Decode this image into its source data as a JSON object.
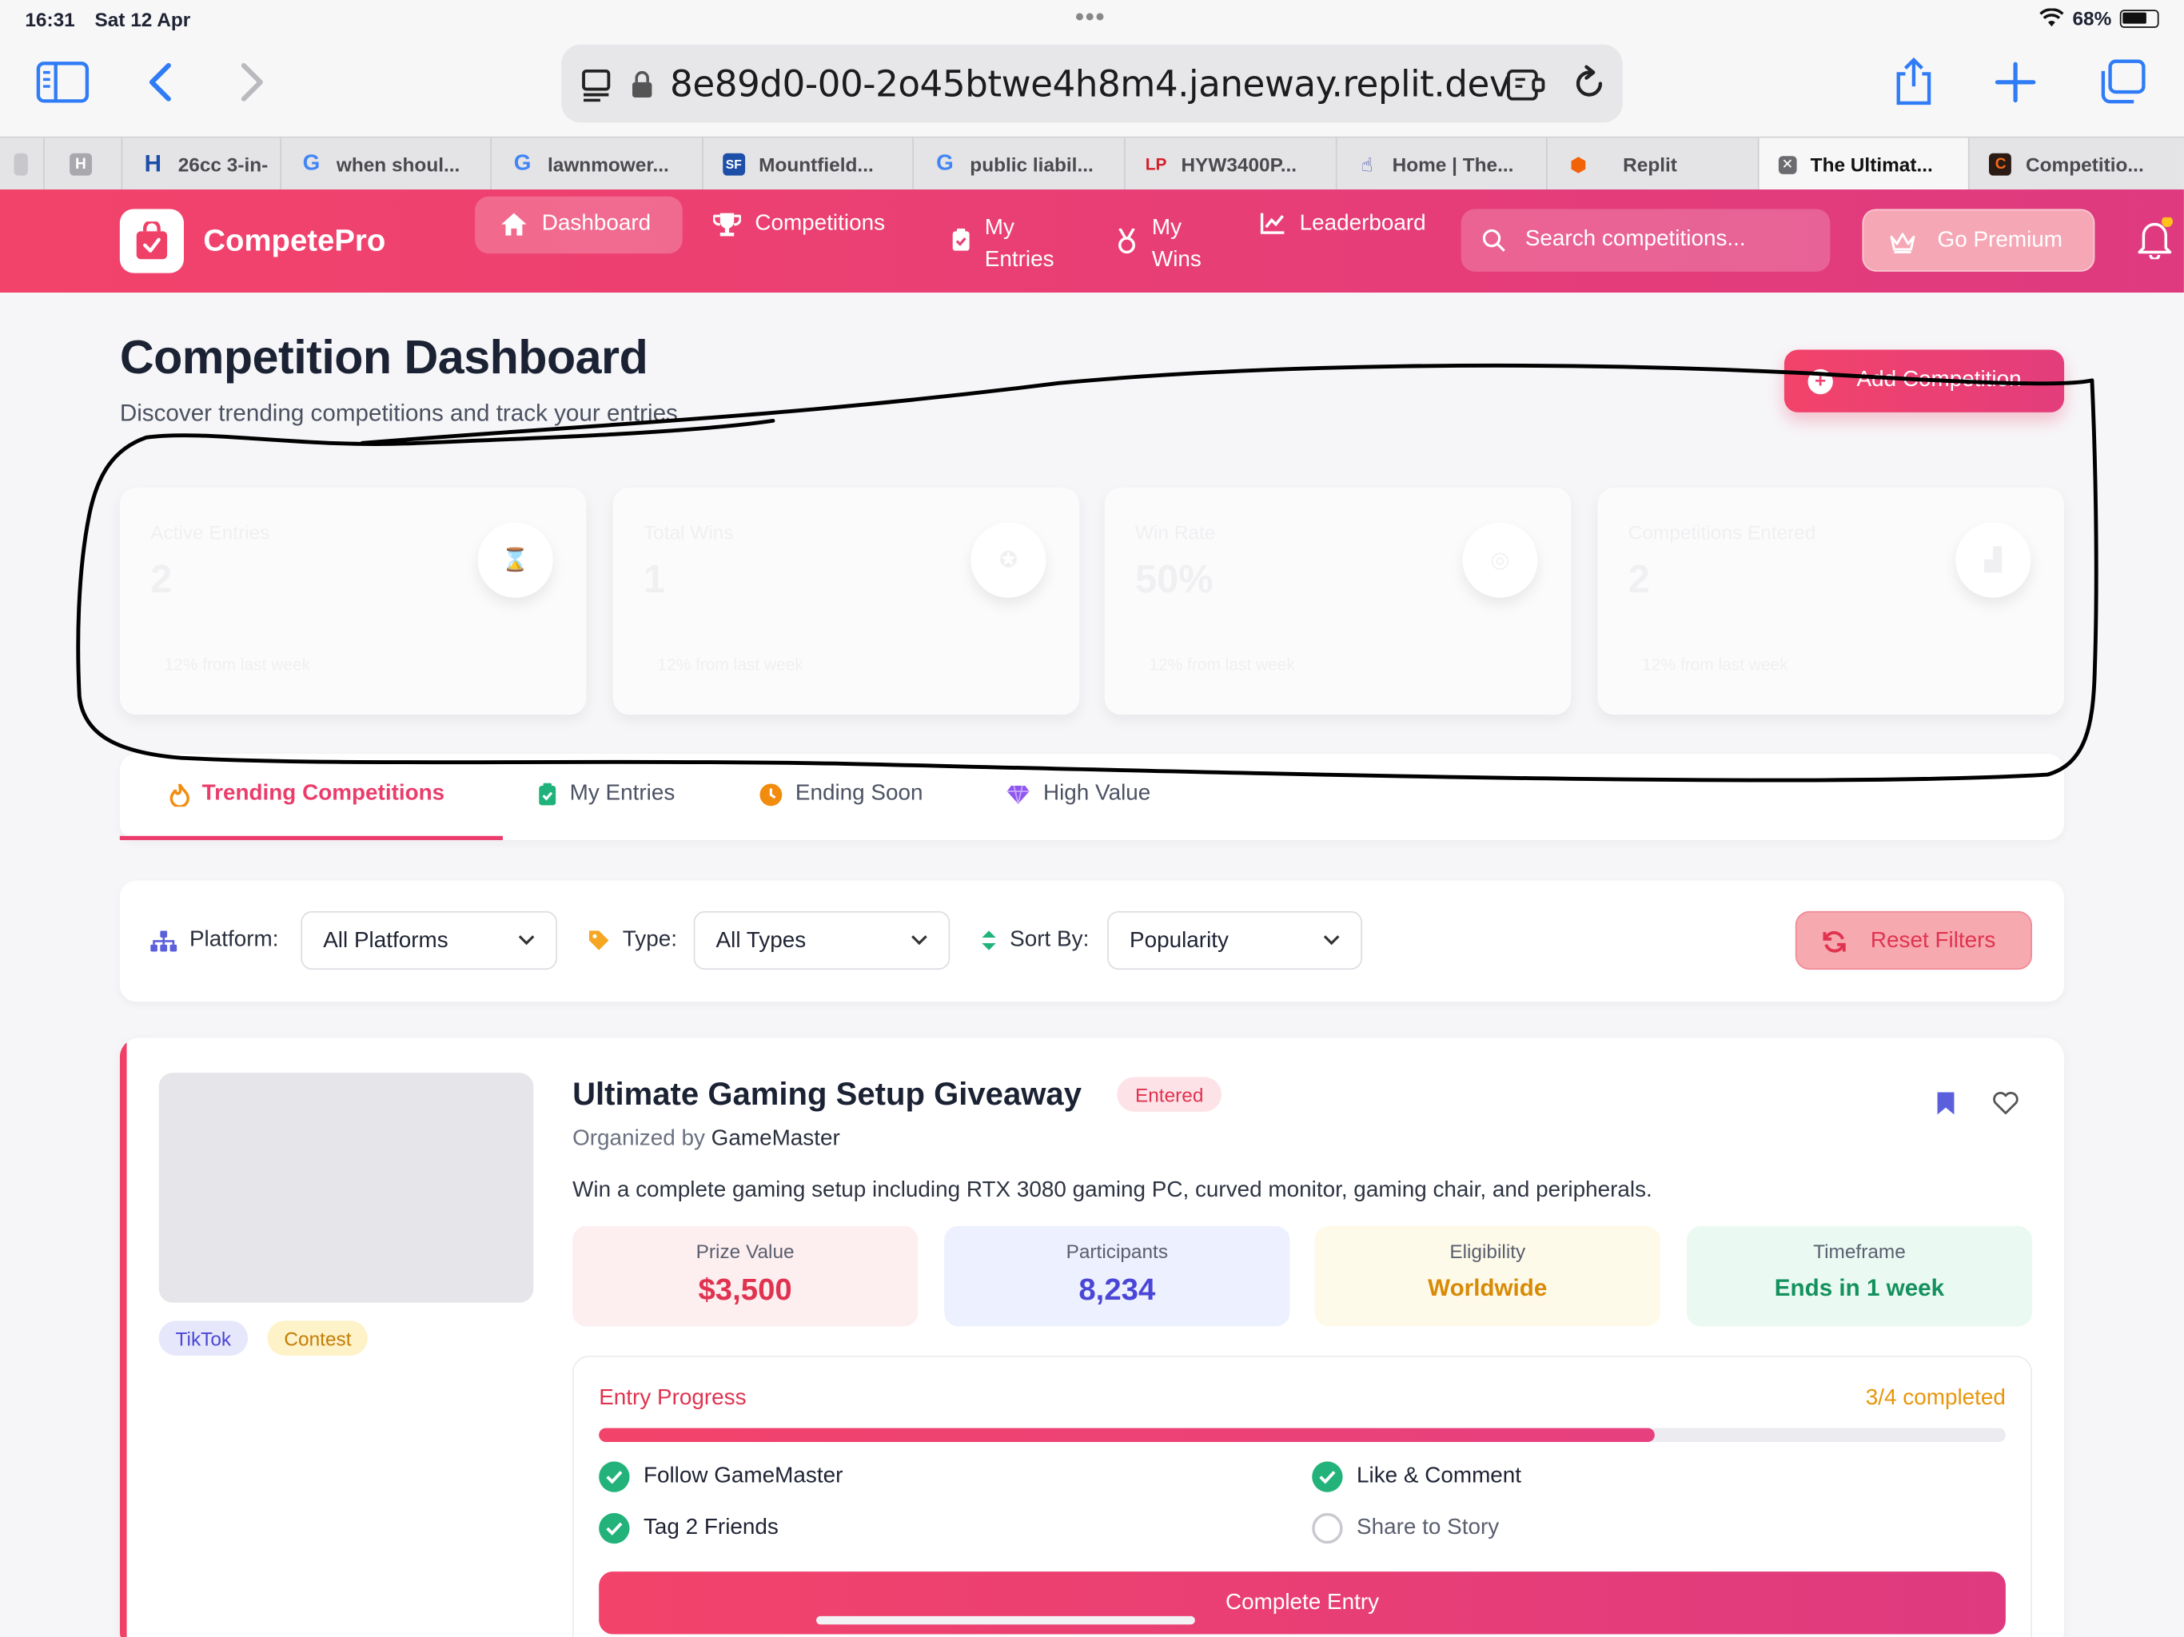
{
  "status": {
    "time": "16:31",
    "date": "Sat 12 Apr",
    "battery": "68%"
  },
  "browser": {
    "url": "8e89d0-00-2o45btwe4h8m4.janeway.replit.dev",
    "tabs": [
      {
        "label": "",
        "favicon": "H",
        "favicon_bg": "#a8a8ad"
      },
      {
        "label": "26cc 3-in-",
        "favicon": "H",
        "favicon_bg": "#1d4fa8"
      },
      {
        "label": "when shoul...",
        "favicon": "G",
        "favicon_bg": "#ffffff"
      },
      {
        "label": "lawnmower...",
        "favicon": "G",
        "favicon_bg": "#ffffff"
      },
      {
        "label": "Mountfield...",
        "favicon": "SF",
        "favicon_bg": "#1d4fa8"
      },
      {
        "label": "public liabil...",
        "favicon": "G",
        "favicon_bg": "#ffffff"
      },
      {
        "label": "HYW3400P...",
        "favicon": "LP",
        "favicon_bg": "#ffffff"
      },
      {
        "label": "Home | The...",
        "favicon": "hand",
        "favicon_bg": "#ffffff"
      },
      {
        "label": "Replit",
        "favicon": "R",
        "favicon_bg": "#ffffff"
      },
      {
        "label": "The Ultimat...",
        "favicon": "x",
        "favicon_bg": "#6b6b70"
      },
      {
        "label": "Competitio...",
        "favicon": "C",
        "favicon_bg": "#b23a1c"
      }
    ],
    "active_tab_index": 9
  },
  "nav": {
    "brand": "CompetePro",
    "items": [
      {
        "label": "Dashboard",
        "icon": "home-icon"
      },
      {
        "label": "Competitions",
        "icon": "trophy-icon"
      },
      {
        "label_line1": "My",
        "label_line2": "Entries",
        "icon": "clipboard-check-icon"
      },
      {
        "label_line1": "My",
        "label_line2": "Wins",
        "icon": "medal-icon"
      },
      {
        "label": "Leaderboard",
        "icon": "chart-line-icon"
      }
    ],
    "search_placeholder": "Search competitions...",
    "premium_label": "Go Premium"
  },
  "header": {
    "title": "Competition Dashboard",
    "subtitle": "Discover trending competitions and track your entries",
    "add_button": "Add Competition"
  },
  "stats": [
    {
      "label": "Active Entries",
      "value": "2",
      "trend": "12% from last week",
      "icon": "hourglass-icon"
    },
    {
      "label": "Total Wins",
      "value": "1",
      "trend": "12% from last week",
      "icon": "award-icon"
    },
    {
      "label": "Win Rate",
      "value": "50%",
      "trend": "12% from last week",
      "icon": "target-icon"
    },
    {
      "label": "Competitions Entered",
      "value": "2",
      "trend": "12% from last week",
      "icon": "chart-icon"
    }
  ],
  "content_tabs": [
    {
      "label": "Trending Competitions",
      "icon": "fire-icon",
      "active": true
    },
    {
      "label": "My Entries",
      "icon": "clipboard-check-icon",
      "active": false
    },
    {
      "label": "Ending Soon",
      "icon": "clock-icon",
      "active": false
    },
    {
      "label": "High Value",
      "icon": "gem-icon",
      "active": false
    }
  ],
  "filters": {
    "platform_label": "Platform:",
    "platform_value": "All Platforms",
    "type_label": "Type:",
    "type_value": "All Types",
    "sort_label": "Sort By:",
    "sort_value": "Popularity",
    "reset_label": "Reset Filters"
  },
  "competition": {
    "title": "Ultimate Gaming Setup Giveaway",
    "status_badge": "Entered",
    "organizer_prefix": "Organized by",
    "organizer": "GameMaster",
    "description": "Win a complete gaming setup including RTX 3080 gaming PC, curved monitor, gaming chair, and peripherals.",
    "tags": [
      "TikTok",
      "Contest"
    ],
    "metrics": [
      {
        "label": "Prize Value",
        "value": "$3,500",
        "color": "#e0334f",
        "bg": "#fdeef0"
      },
      {
        "label": "Participants",
        "value": "8,234",
        "color": "#4a47d6",
        "bg": "#edf0fe"
      },
      {
        "label": "Eligibility",
        "value": "Worldwide",
        "color": "#d98a06",
        "bg": "#fefaea"
      },
      {
        "label": "Timeframe",
        "value": "Ends in 1 week",
        "color": "#14915d",
        "bg": "#eafaf3"
      }
    ],
    "progress": {
      "title": "Entry Progress",
      "count_text": "3/4 completed",
      "fraction": 0.75,
      "tasks": [
        {
          "label": "Follow GameMaster",
          "done": true
        },
        {
          "label": "Like & Comment",
          "done": true
        },
        {
          "label": "Tag 2 Friends",
          "done": true
        },
        {
          "label": "Share to Story",
          "done": false
        }
      ]
    },
    "complete_label": "Complete Entry"
  }
}
